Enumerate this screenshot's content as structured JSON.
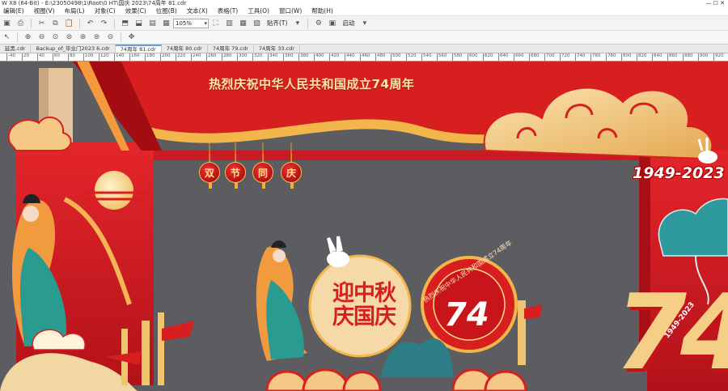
{
  "app": {
    "title": "W X8 (64-Bit) - E:\\23050498\\1\\Root\\0 HT\\国庆 2023\\74周年 81.cdr"
  },
  "menu": [
    "编辑(E)",
    "视图(V)",
    "布局(L)",
    "对象(C)",
    "效果(C)",
    "位图(B)",
    "文本(X)",
    "表格(T)",
    "工具(O)",
    "窗口(W)",
    "帮助(H)"
  ],
  "toolbar": {
    "zoom_value": "105%",
    "snap_label": "贴齐(T)",
    "launch_label": "启动"
  },
  "tabs": [
    "延黑.cdr",
    "Backup_of_毕业门2023 6.cdr",
    "74周年 81.cdr",
    "74周年 80.cdr",
    "74周年 79.cdr",
    "74周年 33.cdr"
  ],
  "active_tab": 2,
  "ruler_marks": [
    "-40",
    "20",
    "40",
    "60",
    "80",
    "100",
    "120",
    "140",
    "160",
    "180",
    "200",
    "220",
    "240",
    "260",
    "280",
    "300",
    "320",
    "340",
    "360",
    "380",
    "400",
    "420",
    "440",
    "460",
    "480",
    "500",
    "520",
    "540",
    "560",
    "580",
    "600",
    "620",
    "640",
    "660",
    "680",
    "700",
    "720",
    "740",
    "760",
    "780",
    "800",
    "820",
    "840",
    "860",
    "880",
    "900",
    "920"
  ],
  "artwork": {
    "banner_title": "热烈庆祝中华人民共和国成立74周年",
    "lanterns": [
      "双",
      "节",
      "同",
      "庆"
    ],
    "year_badge": "1949-2023",
    "seal_text": "迎中秋庆国庆",
    "ring_text": "热烈庆祝中华人民共和国成立74周年",
    "circle_number": "74",
    "big_number": "74",
    "big_years": "1949-2023"
  },
  "colors": {
    "red": "#d81f1f",
    "dark_red": "#a30d12",
    "gold": "#f5cf86",
    "teal": "#2a8f8a",
    "canvas_gray": "#5d5d61"
  }
}
